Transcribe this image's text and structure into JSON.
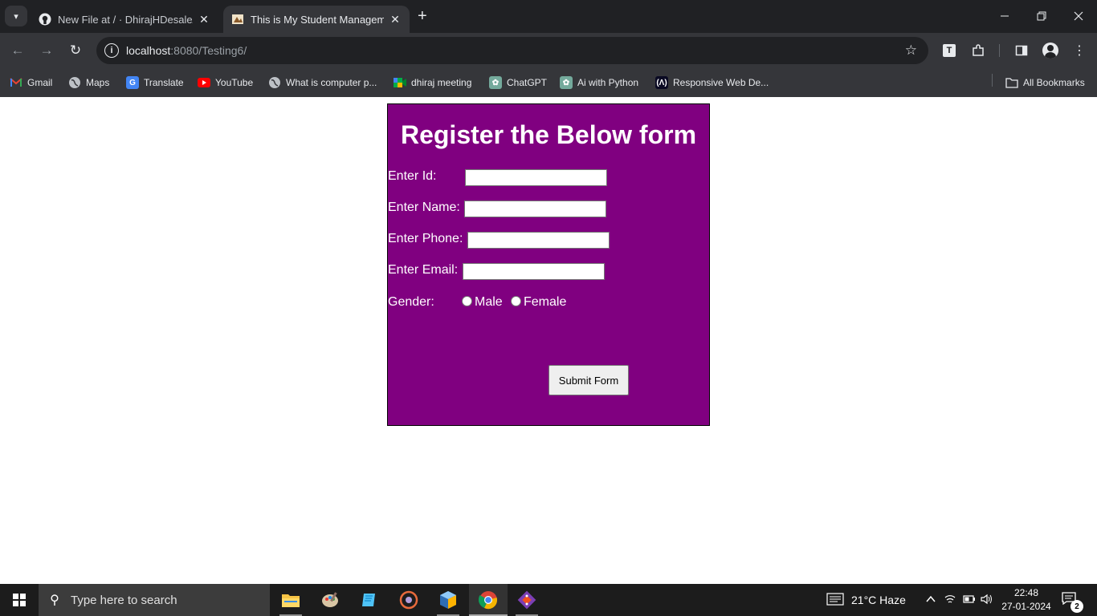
{
  "browser": {
    "tabs": [
      {
        "title": "New File at / · DhirajHDesale/Student",
        "favicon": "github-icon"
      },
      {
        "title": "This is My Student Management",
        "favicon": "student-page-icon"
      }
    ],
    "url_host": "localhost",
    "url_path": ":8080/Testing6/",
    "bookmarks": [
      {
        "label": "Gmail",
        "icon": "gmail-icon"
      },
      {
        "label": "Maps",
        "icon": "globe-icon"
      },
      {
        "label": "Translate",
        "icon": "translate-icon"
      },
      {
        "label": "YouTube",
        "icon": "youtube-icon"
      },
      {
        "label": "What is computer p...",
        "icon": "globe-icon"
      },
      {
        "label": "dhiraj meeting",
        "icon": "meet-icon"
      },
      {
        "label": "ChatGPT",
        "icon": "chatgpt-icon"
      },
      {
        "label": "Ai with Python",
        "icon": "chatgpt-icon"
      },
      {
        "label": "Responsive Web De...",
        "icon": "web-design-icon"
      }
    ],
    "all_bookmarks": "All Bookmarks",
    "extension_letter": "T"
  },
  "form": {
    "title": "Register the Below form",
    "id_label": "Enter Id:",
    "name_label": "Enter Name:",
    "phone_label": "Enter Phone:",
    "email_label": "Enter Email:",
    "gender_label": "Gender:",
    "male_label": "Male",
    "female_label": "Female",
    "submit_label": "Submit Form",
    "background": "#800080"
  },
  "taskbar": {
    "search_placeholder": "Type here to search",
    "weather": "21°C  Haze",
    "time": "22:48",
    "date": "27-01-2024",
    "notification_count": "2"
  }
}
